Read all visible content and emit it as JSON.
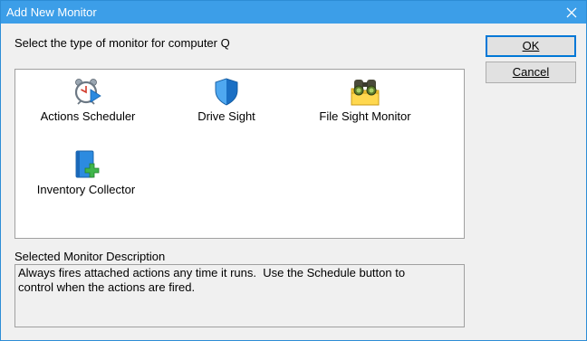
{
  "window": {
    "title": "Add New Monitor",
    "close_glyph": "close-icon"
  },
  "prompt": "Select the type of monitor for computer Q",
  "buttons": {
    "ok_label": "OK",
    "cancel_label": "Cancel"
  },
  "monitors": [
    {
      "label": "Actions Scheduler",
      "icon": "alarm-clock-play-icon"
    },
    {
      "label": "Drive Sight",
      "icon": "shield-icon"
    },
    {
      "label": "File Sight Monitor",
      "icon": "binoculars-folder-icon"
    },
    {
      "label": "Inventory Collector",
      "icon": "book-add-icon"
    }
  ],
  "description": {
    "label": "Selected Monitor Description",
    "text": "Always fires attached actions any time it runs.  Use the Schedule button to\ncontrol when the actions are fired."
  },
  "colors": {
    "titlebar": "#3c9ee8",
    "window_bg": "#f0f0f0",
    "list_bg": "#ffffff",
    "default_button_border": "#0078d7"
  }
}
